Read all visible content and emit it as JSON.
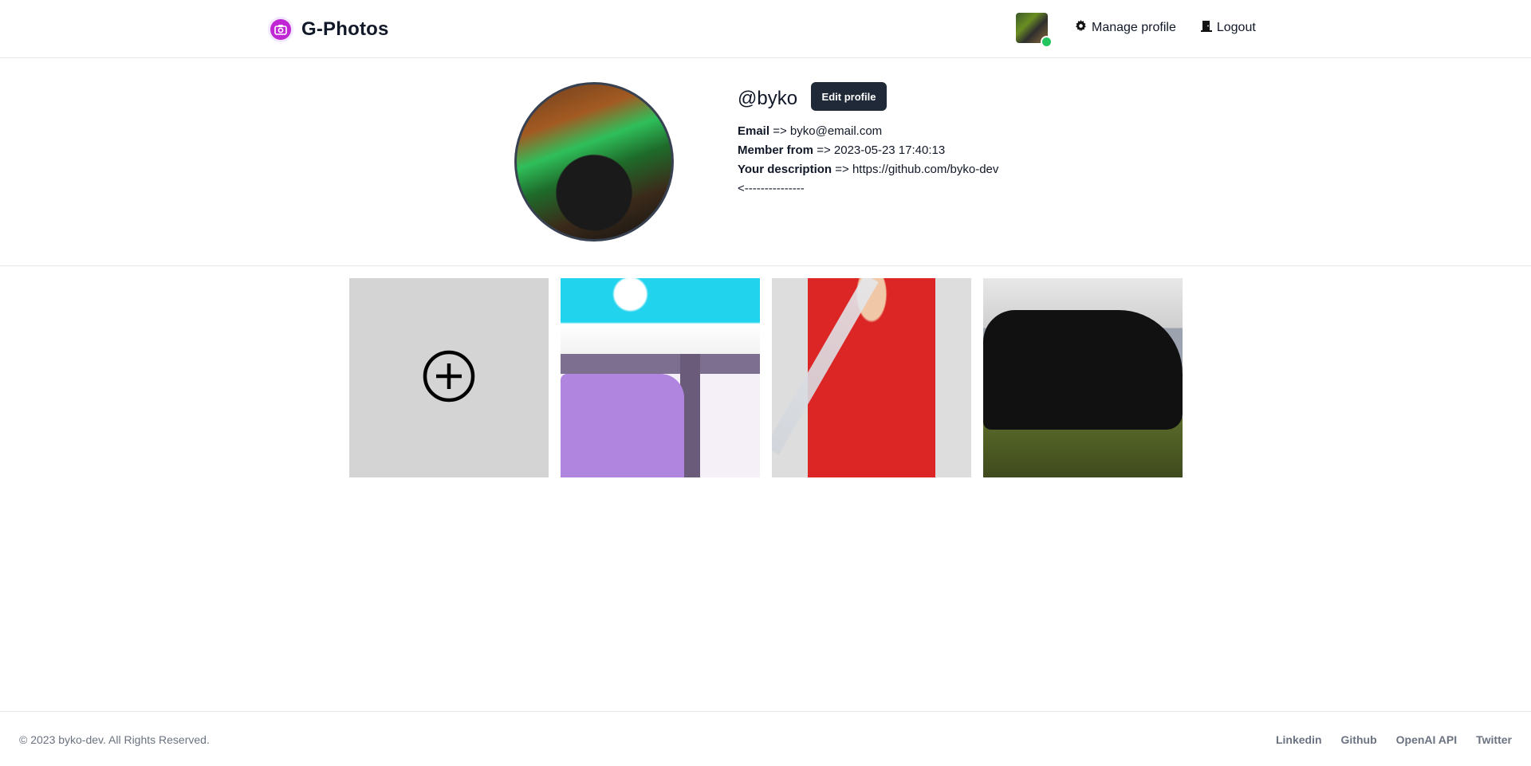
{
  "header": {
    "brand": "G-Photos",
    "manage_label": "Manage profile",
    "logout_label": "Logout",
    "online_color": "#22c55e",
    "brand_color": "#c026d3"
  },
  "profile": {
    "username": "@byko",
    "edit_label": "Edit profile",
    "email_label": "Email",
    "email_value": "byko@email.com",
    "member_label": "Member from",
    "member_value": "2023-05-23 17:40:13",
    "description_label": "Your description",
    "description_value": "https://github.com/byko-dev <---------------",
    "separator": "=>"
  },
  "gallery": {
    "add_icon": "plus-circle-icon",
    "photos": [
      {
        "name": "purple-car-illustration"
      },
      {
        "name": "red-uniform-portrait"
      },
      {
        "name": "black-car-photo"
      }
    ]
  },
  "footer": {
    "copyright": "© 2023 byko-dev. All Rights Reserved.",
    "links": [
      "Linkedin",
      "Github",
      "OpenAI API",
      "Twitter"
    ]
  }
}
